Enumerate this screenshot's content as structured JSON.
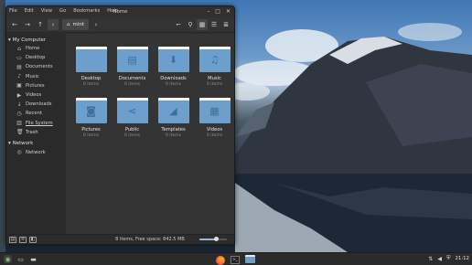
{
  "window": {
    "title": "Home",
    "menu": [
      "File",
      "Edit",
      "View",
      "Go",
      "Bookmarks",
      "Help"
    ],
    "controls": {
      "minimize": "–",
      "maximize": "□",
      "close": "✕"
    }
  },
  "toolbar": {
    "back_icon": "arrow-left-icon",
    "forward_icon": "arrow-right-icon",
    "up_icon": "arrow-up-icon",
    "breadcrumb_toggle_icon": "chevron-left-icon",
    "location": "mint",
    "location_icon": "home-icon",
    "breadcrumb_next_icon": "chevron-right-icon"
  },
  "sidebar": {
    "sections": [
      {
        "title": "My Computer",
        "items": [
          {
            "label": "Home",
            "icon": "home-icon"
          },
          {
            "label": "Desktop",
            "icon": "desktop-icon"
          },
          {
            "label": "Documents",
            "icon": "documents-icon"
          },
          {
            "label": "Music",
            "icon": "music-icon"
          },
          {
            "label": "Pictures",
            "icon": "pictures-icon"
          },
          {
            "label": "Videos",
            "icon": "videos-icon"
          },
          {
            "label": "Downloads",
            "icon": "downloads-icon"
          },
          {
            "label": "Recent",
            "icon": "recent-icon"
          },
          {
            "label": "File System",
            "icon": "filesystem-icon",
            "selected": true
          },
          {
            "label": "Trash",
            "icon": "trash-icon"
          }
        ]
      },
      {
        "title": "Network",
        "items": [
          {
            "label": "Network",
            "icon": "network-icon"
          }
        ]
      }
    ]
  },
  "files": [
    {
      "name": "Desktop",
      "meta": "0 items",
      "icon": "desktop-folder-icon"
    },
    {
      "name": "Documents",
      "meta": "0 items",
      "icon": "documents-folder-icon"
    },
    {
      "name": "Downloads",
      "meta": "0 items",
      "icon": "downloads-folder-icon"
    },
    {
      "name": "Music",
      "meta": "0 items",
      "icon": "music-folder-icon"
    },
    {
      "name": "Pictures",
      "meta": "0 items",
      "icon": "pictures-folder-icon"
    },
    {
      "name": "Public",
      "meta": "0 items",
      "icon": "public-folder-icon"
    },
    {
      "name": "Templates",
      "meta": "0 items",
      "icon": "templates-folder-icon"
    },
    {
      "name": "Videos",
      "meta": "0 items",
      "icon": "videos-folder-icon"
    }
  ],
  "statusbar": {
    "text": "8 items, Free space: 842.5 MB",
    "zoom_level": 0.6
  },
  "taskbar": {
    "clock": "21:12",
    "apps": [
      "firefox-icon",
      "terminal-icon",
      "files-icon"
    ]
  },
  "colors": {
    "folder": "#6c9fcb",
    "window_bg": "#2e2e2e",
    "accent": "#9ab7d3"
  }
}
